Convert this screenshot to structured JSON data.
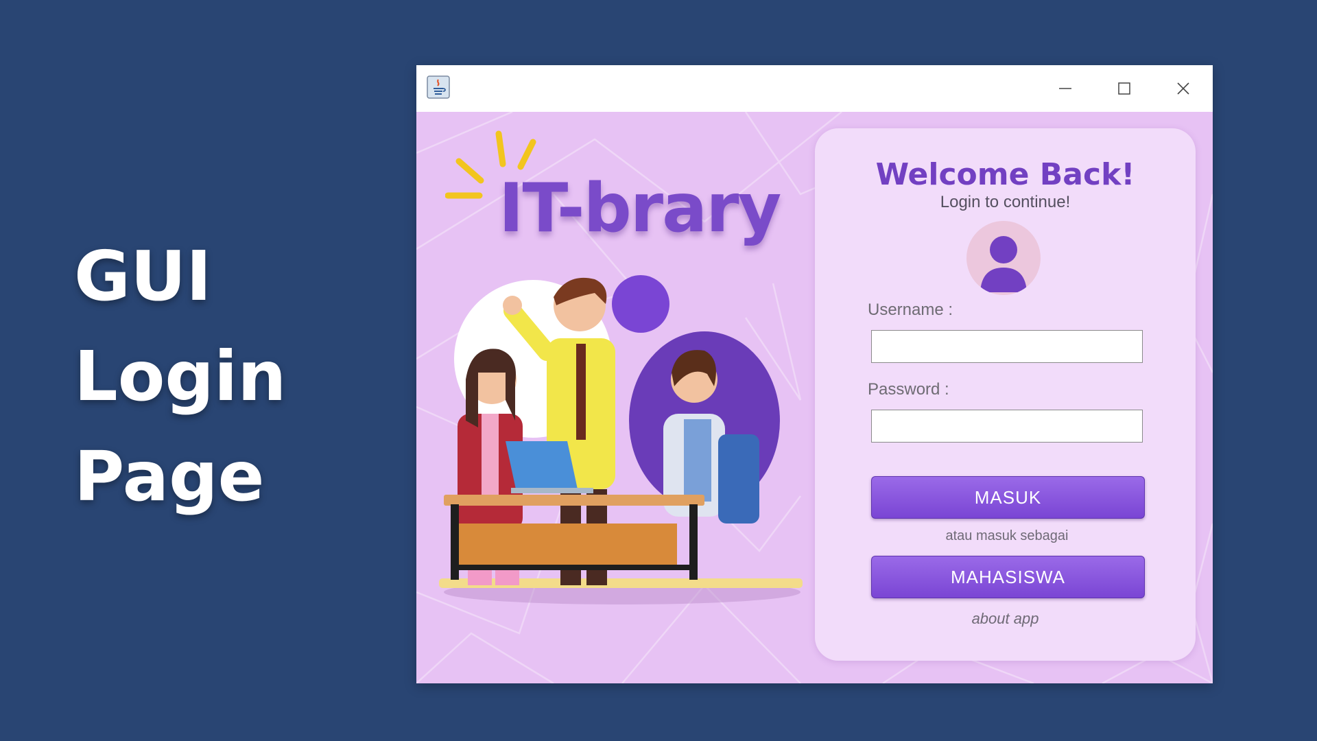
{
  "slide": {
    "title_lines": [
      "GUI",
      "Login",
      "Page"
    ]
  },
  "window": {
    "icons": {
      "app": "java-app-icon",
      "minimize": "minimize-icon",
      "maximize": "maximize-icon",
      "close": "close-icon"
    },
    "logo_text": "IT-brary",
    "login": {
      "title": "Welcome Back!",
      "subtitle": "Login to continue!",
      "avatar_icon": "user-icon",
      "username_label": "Username :",
      "username_value": "",
      "password_label": "Password :",
      "password_value": "",
      "submit_label": "MASUK",
      "or_text": "atau masuk sebagai",
      "student_label": "MAHASISWA",
      "about_label": "about app"
    }
  },
  "colors": {
    "slide_background": "#294573",
    "window_background": "#e7c2f4",
    "card_background": "#f2dcfa",
    "accent_purple": "#7a45d4",
    "logo_text": "#7a4bc9",
    "logo_rays": "#f2c51e"
  }
}
